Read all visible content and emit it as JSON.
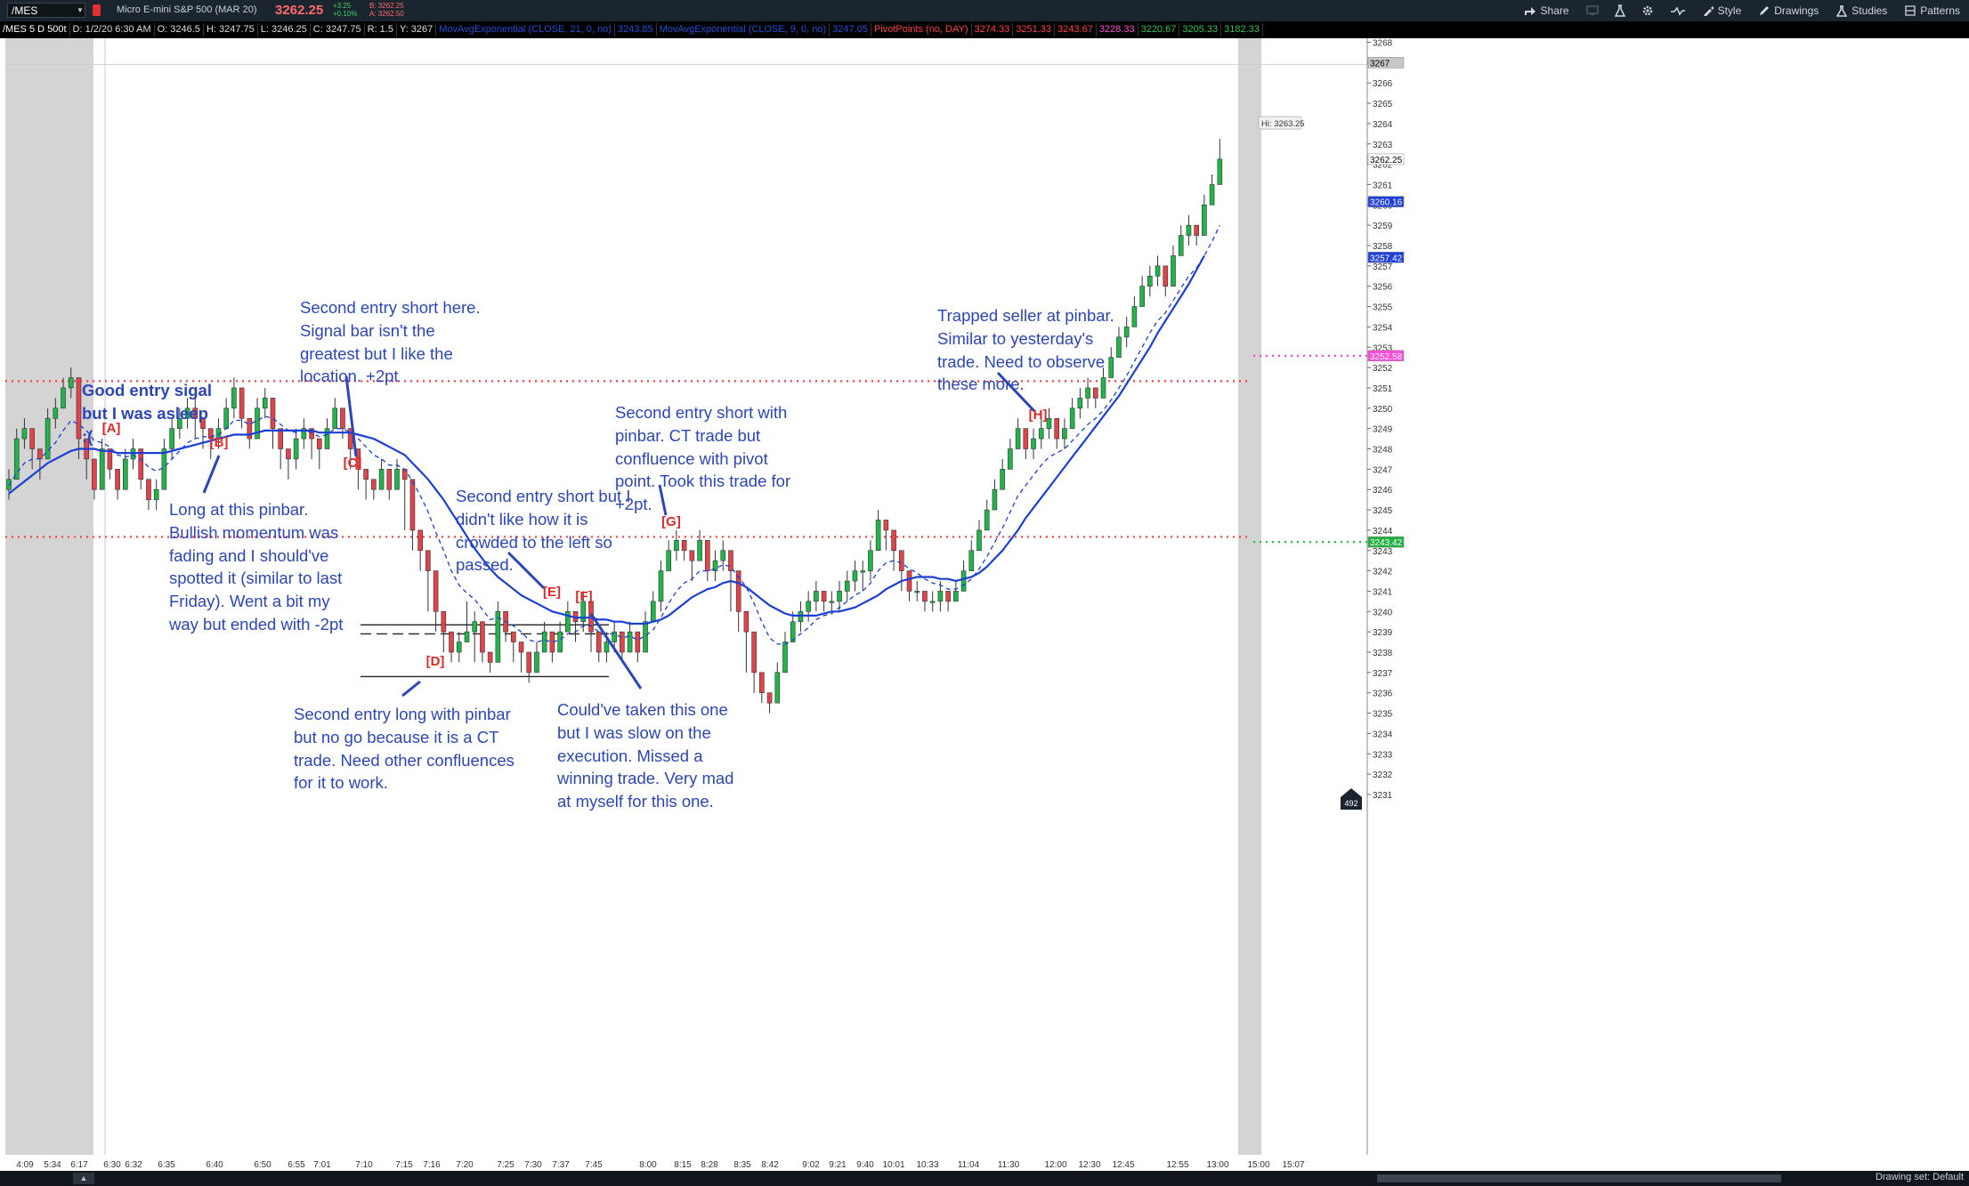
{
  "header": {
    "symbol": "/MES",
    "description": "Micro E-mini S&P 500 (MAR 20)",
    "last": "3262.25",
    "change": "+3.25",
    "change_pct": "+0.10%",
    "bid": "B: 3262.25",
    "ask": "A: 3262.50",
    "tools": [
      "Share",
      "Style",
      "Drawings",
      "Studies",
      "Patterns"
    ]
  },
  "studybar": {
    "items": [
      {
        "text": "/MES 5 D 500t",
        "color": "#ffffff"
      },
      {
        "text": "D: 1/2/20 6:30 AM",
        "color": "#dddddd"
      },
      {
        "text": "O: 3246.5",
        "color": "#dddddd"
      },
      {
        "text": "H: 3247.75",
        "color": "#dddddd"
      },
      {
        "text": "L: 3246.25",
        "color": "#dddddd"
      },
      {
        "text": "C: 3247.75",
        "color": "#dddddd"
      },
      {
        "text": "R: 1.5",
        "color": "#dddddd"
      },
      {
        "text": "Y: 3267",
        "color": "#dddddd"
      },
      {
        "text": "MovAvgExponential (CLOSE, 21, 0, no)",
        "color": "#1e4fd8"
      },
      {
        "text": "3243.85",
        "color": "#1e4fd8"
      },
      {
        "text": "MovAvgExponential (CLOSE, 9, 0, no)",
        "color": "#1e4fd8"
      },
      {
        "text": "3247.05",
        "color": "#1e4fd8"
      },
      {
        "text": "PivotPoints (no, DAY)",
        "color": "#ff4040"
      },
      {
        "text": "3274.33",
        "color": "#ff4040"
      },
      {
        "text": "3251.33",
        "color": "#ff4040"
      },
      {
        "text": "3243.67",
        "color": "#ff4040"
      },
      {
        "text": "3228.33",
        "color": "#ff4bd8"
      },
      {
        "text": "3220.67",
        "color": "#31c44a"
      },
      {
        "text": "3205.33",
        "color": "#31c44a"
      },
      {
        "text": "3182.33",
        "color": "#31c44a"
      }
    ]
  },
  "chart_data": {
    "type": "candlestick",
    "ylim": [
      3230,
      3268
    ],
    "y_ticks": [
      3231,
      3232,
      3233,
      3234,
      3235,
      3236,
      3237,
      3238,
      3239,
      3240,
      3241,
      3242,
      3243,
      3244,
      3245,
      3246,
      3247,
      3248,
      3249,
      3250,
      3251,
      3252,
      3253,
      3254,
      3255,
      3256,
      3257,
      3258,
      3259,
      3260,
      3261,
      3262,
      3263,
      3264,
      3265,
      3266,
      3267,
      3268
    ],
    "x_ticks": [
      "4:09",
      "5:34",
      "6:17",
      "6:30",
      "6:32",
      "6:35",
      "6:40",
      "6:50",
      "6:55",
      "7:01",
      "7:10",
      "7:15",
      "7:16",
      "7:20",
      "7:25",
      "7:30",
      "7:37",
      "7:45",
      "8:00",
      "8:15",
      "8:28",
      "8:35",
      "8:42",
      "9:02",
      "9:21",
      "9:40",
      "10:01",
      "10:33",
      "11:04",
      "11:30",
      "12:00",
      "12:30",
      "12:45",
      "12:55",
      "13:00",
      "15:00",
      "15:07"
    ],
    "closes": [
      3246.5,
      3248.5,
      3249,
      3248,
      3247.5,
      3249.5,
      3250,
      3251,
      3251.5,
      3248.5,
      3247.5,
      3246,
      3248,
      3247,
      3246,
      3247.5,
      3248,
      3246.5,
      3245.5,
      3246,
      3248,
      3249,
      3249.5,
      3250,
      3249.5,
      3249,
      3248.5,
      3249,
      3250,
      3251,
      3249.5,
      3248.5,
      3250,
      3250.5,
      3249,
      3248,
      3247.5,
      3248.5,
      3249,
      3248.5,
      3248,
      3249,
      3250,
      3249,
      3248,
      3247,
      3246.5,
      3246,
      3247,
      3246,
      3247,
      3246.5,
      3244,
      3243,
      3242,
      3240,
      3239,
      3238,
      3238.5,
      3239,
      3239.5,
      3238,
      3237.5,
      3240,
      3239,
      3238.5,
      3238,
      3237,
      3238,
      3239,
      3238,
      3239,
      3240,
      3239.5,
      3240.5,
      3239,
      3238,
      3238.5,
      3239,
      3238,
      3239,
      3238,
      3239.5,
      3240.5,
      3242,
      3243,
      3243.5,
      3243,
      3242.5,
      3243.5,
      3242,
      3242.5,
      3243,
      3242,
      3240,
      3239,
      3237,
      3236,
      3235.5,
      3237,
      3238.5,
      3239.5,
      3240,
      3240.5,
      3241,
      3240.5,
      3240.5,
      3241,
      3241.5,
      3242,
      3242,
      3243,
      3244.5,
      3244,
      3243,
      3242,
      3241,
      3241,
      3240.5,
      3240.5,
      3241,
      3240.5,
      3241,
      3242,
      3243,
      3244,
      3245,
      3246,
      3247,
      3248,
      3249,
      3248,
      3248.5,
      3249,
      3249.5,
      3248.5,
      3249,
      3250,
      3250.5,
      3251,
      3250.5,
      3251.5,
      3252.5,
      3253.5,
      3254,
      3255,
      3256,
      3256.5,
      3257,
      3256,
      3257.5,
      3258.5,
      3259,
      3258.5,
      3260,
      3261,
      3262.25
    ],
    "highs": [
      3247,
      3249,
      3249.5,
      3248.5,
      3248,
      3250,
      3250.5,
      3251.5,
      3252,
      3249,
      3248.5,
      3246.5,
      3248.5,
      3247.5,
      3246.5,
      3248,
      3248.5,
      3247,
      3246,
      3246.5,
      3248.5,
      3249.5,
      3250,
      3250.5,
      3250.5,
      3249.5,
      3249,
      3249.5,
      3250.5,
      3251.5,
      3250,
      3249,
      3250.5,
      3251,
      3249.5,
      3248.5,
      3248,
      3249,
      3249.5,
      3249,
      3248.5,
      3249.5,
      3250.5,
      3249.5,
      3248.5,
      3247.5,
      3247,
      3246.5,
      3247.5,
      3246.5,
      3247.5,
      3247,
      3244.5,
      3243.5,
      3242.5,
      3240.5,
      3239.5,
      3238.5,
      3239,
      3240.5,
      3240,
      3238.5,
      3238,
      3240.5,
      3239.5,
      3239,
      3238.5,
      3237.5,
      3238.5,
      3239.5,
      3238.5,
      3239.5,
      3240.5,
      3240,
      3241,
      3239.5,
      3238.5,
      3239,
      3239.5,
      3238.5,
      3239.5,
      3238.5,
      3240,
      3241,
      3242.5,
      3243.5,
      3244,
      3243.5,
      3243,
      3244,
      3242.5,
      3243,
      3243.5,
      3242.5,
      3240.5,
      3239.5,
      3237.5,
      3236.5,
      3236,
      3237.5,
      3239,
      3240,
      3240.5,
      3241,
      3241.5,
      3241,
      3241,
      3241.5,
      3242,
      3242.5,
      3242.5,
      3243.5,
      3245,
      3244.5,
      3243.5,
      3242.5,
      3241.5,
      3241.5,
      3241,
      3241,
      3241.5,
      3241,
      3241.5,
      3242.5,
      3243.5,
      3244.5,
      3245.5,
      3246.5,
      3247.5,
      3248.5,
      3249.5,
      3248.5,
      3249,
      3249.5,
      3250,
      3249,
      3249.5,
      3250.5,
      3251,
      3251.5,
      3251,
      3252,
      3253,
      3254,
      3254.5,
      3255.5,
      3256.5,
      3257,
      3257.5,
      3256.5,
      3258,
      3259,
      3259.5,
      3259,
      3260.5,
      3261.5,
      3263.25
    ],
    "lows": [
      3245.5,
      3246.5,
      3248,
      3247,
      3246.5,
      3248.5,
      3249,
      3250,
      3250.5,
      3247.5,
      3246.5,
      3245.5,
      3246,
      3246.5,
      3245.5,
      3246,
      3247,
      3246,
      3245,
      3245,
      3246,
      3247.5,
      3248.5,
      3249,
      3248.5,
      3248,
      3247.5,
      3248,
      3249,
      3249.5,
      3249,
      3248,
      3248.5,
      3249.5,
      3248,
      3247,
      3246.5,
      3247,
      3248,
      3247.5,
      3247,
      3248,
      3249,
      3248.5,
      3247,
      3246,
      3245.5,
      3245.5,
      3246,
      3245.5,
      3246,
      3244,
      3243,
      3242,
      3240,
      3239,
      3238,
      3237.5,
      3237.5,
      3238.5,
      3237.5,
      3237.5,
      3237,
      3237.5,
      3238.5,
      3237.5,
      3237,
      3236.5,
      3237,
      3238,
      3237.5,
      3238,
      3239,
      3238.5,
      3239,
      3238,
      3237.5,
      3237.5,
      3238,
      3237.5,
      3238,
      3237.5,
      3238,
      3239.5,
      3240,
      3242,
      3242.5,
      3242.5,
      3241.5,
      3242.5,
      3241.5,
      3241.5,
      3242,
      3240,
      3239,
      3237,
      3236,
      3235.5,
      3235,
      3235.5,
      3237,
      3238.5,
      3239,
      3239.5,
      3240,
      3240,
      3240,
      3240,
      3240.5,
      3241,
      3241,
      3241.5,
      3243,
      3243,
      3242,
      3241,
      3240.5,
      3240.5,
      3240,
      3240,
      3240,
      3240,
      3240.5,
      3241,
      3242,
      3243,
      3244,
      3245,
      3246,
      3247,
      3248,
      3247.5,
      3247.5,
      3248,
      3248.5,
      3248,
      3248,
      3249,
      3249.5,
      3250,
      3250,
      3250.5,
      3251.5,
      3252.5,
      3253,
      3254,
      3255,
      3255.5,
      3256,
      3255.5,
      3256,
      3257.5,
      3258,
      3258,
      3258.5,
      3260,
      3261
    ],
    "ema21": [
      3245.8,
      3246.1,
      3246.4,
      3246.7,
      3247.0,
      3247.3,
      3247.5,
      3247.7,
      3247.9,
      3248.0,
      3248.0,
      3248.0,
      3247.9,
      3247.9,
      3247.8,
      3247.8,
      3247.8,
      3247.8,
      3247.8,
      3247.8,
      3247.8,
      3247.9,
      3248.0,
      3248.1,
      3248.2,
      3248.3,
      3248.4,
      3248.5,
      3248.6,
      3248.7,
      3248.7,
      3248.7,
      3248.8,
      3248.9,
      3248.9,
      3248.9,
      3248.9,
      3248.9,
      3248.9,
      3248.9,
      3248.8,
      3248.8,
      3248.8,
      3248.8,
      3248.8,
      3248.7,
      3248.6,
      3248.5,
      3248.3,
      3248.1,
      3247.9,
      3247.7,
      3247.3,
      3246.9,
      3246.5,
      3246.0,
      3245.5,
      3244.9,
      3244.3,
      3243.7,
      3243.1,
      3242.6,
      3242.1,
      3241.7,
      3241.4,
      3241.1,
      3240.8,
      3240.6,
      3240.4,
      3240.2,
      3240.0,
      3239.9,
      3239.8,
      3239.7,
      3239.7,
      3239.7,
      3239.6,
      3239.6,
      3239.5,
      3239.5,
      3239.4,
      3239.4,
      3239.4,
      3239.5,
      3239.6,
      3239.8,
      3240.1,
      3240.4,
      3240.7,
      3240.9,
      3241.1,
      3241.2,
      3241.4,
      3241.5,
      3241.4,
      3241.2,
      3240.9,
      3240.6,
      3240.3,
      3240.1,
      3239.9,
      3239.8,
      3239.8,
      3239.8,
      3239.8,
      3239.9,
      3240.0,
      3240.0,
      3240.1,
      3240.2,
      3240.4,
      3240.6,
      3240.8,
      3241.1,
      3241.3,
      3241.5,
      3241.6,
      3241.7,
      3241.7,
      3241.7,
      3241.6,
      3241.6,
      3241.5,
      3241.6,
      3241.7,
      3241.9,
      3242.2,
      3242.6,
      3243.0,
      3243.5,
      3244.0,
      3244.6,
      3245.1,
      3245.6,
      3246.1,
      3246.6,
      3247.1,
      3247.6,
      3248.1,
      3248.6,
      3249.1,
      3249.6,
      3250.1,
      3250.6,
      3251.2,
      3251.8,
      3252.4,
      3253.0,
      3253.7,
      3254.3,
      3254.9,
      3255.5,
      3256.1,
      3256.8,
      3257.5
    ],
    "ema9": [
      3246.2,
      3246.8,
      3247.3,
      3247.5,
      3247.5,
      3247.9,
      3248.3,
      3248.9,
      3249.4,
      3249.2,
      3248.9,
      3248.4,
      3248.3,
      3248.1,
      3247.7,
      3247.6,
      3247.7,
      3247.5,
      3247.1,
      3246.9,
      3247.1,
      3247.5,
      3247.9,
      3248.3,
      3248.5,
      3248.6,
      3248.6,
      3248.7,
      3249.0,
      3249.4,
      3249.4,
      3249.2,
      3249.4,
      3249.6,
      3249.5,
      3249.2,
      3248.9,
      3248.8,
      3248.9,
      3248.8,
      3248.6,
      3248.7,
      3249.0,
      3249.0,
      3248.8,
      3248.5,
      3248.1,
      3247.7,
      3247.5,
      3247.2,
      3247.2,
      3247.0,
      3246.4,
      3245.7,
      3244.9,
      3243.9,
      3243.0,
      3242.0,
      3241.3,
      3240.9,
      3240.6,
      3240.1,
      3239.6,
      3239.7,
      3239.5,
      3239.3,
      3239.0,
      3238.6,
      3238.5,
      3238.6,
      3238.5,
      3238.6,
      3238.9,
      3239.0,
      3239.3,
      3239.3,
      3239.0,
      3238.9,
      3238.9,
      3238.7,
      3238.8,
      3238.6,
      3238.8,
      3239.1,
      3239.7,
      3240.4,
      3241.0,
      3241.4,
      3241.6,
      3242.0,
      3242.0,
      3242.1,
      3242.3,
      3242.2,
      3241.7,
      3241.2,
      3240.4,
      3239.5,
      3238.7,
      3238.4,
      3238.4,
      3238.6,
      3238.9,
      3239.2,
      3239.6,
      3239.8,
      3239.9,
      3240.2,
      3240.5,
      3240.8,
      3241.0,
      3241.4,
      3242.0,
      3242.4,
      3242.5,
      3242.4,
      3242.1,
      3241.9,
      3241.6,
      3241.4,
      3241.3,
      3241.1,
      3241.1,
      3241.3,
      3241.6,
      3242.1,
      3242.7,
      3243.4,
      3244.1,
      3244.9,
      3245.7,
      3246.2,
      3246.7,
      3247.2,
      3247.6,
      3247.8,
      3248.0,
      3248.4,
      3248.8,
      3249.2,
      3249.5,
      3249.9,
      3250.4,
      3251.0,
      3251.6,
      3252.3,
      3253.0,
      3253.7,
      3254.3,
      3254.7,
      3255.3,
      3255.9,
      3256.5,
      3256.9,
      3257.5,
      3258.2,
      3259.0
    ],
    "pivot_lines": [
      {
        "level": 3251.33,
        "color": "#ff3b3b"
      },
      {
        "level": 3243.67,
        "color": "#ff3b3b"
      }
    ],
    "price_labels": [
      {
        "value": "3267",
        "bg": "#c7c7c7",
        "color": "#000000",
        "level": 3267
      },
      {
        "value": "3262.25",
        "bg": "#ffffff",
        "color": "#000000",
        "level": 3262.25
      },
      {
        "value": "3260.16",
        "bg": "#1e3fd8",
        "color": "#ffffff",
        "level": 3260.16
      },
      {
        "value": "3257.42",
        "bg": "#1e3fd8",
        "color": "#ffffff",
        "level": 3257.42
      },
      {
        "value": "3252.58",
        "bg": "#ff4bd8",
        "color": "#ffffff",
        "level": 3252.58
      },
      {
        "value": "3243.42",
        "bg": "#22b040",
        "color": "#ffffff",
        "level": 3243.42
      }
    ],
    "hi_label": "Hi: 3263.25",
    "pdr_high": 3243.5,
    "pdr_low": 3236.8,
    "pdr_mid": 3238.9,
    "colors": {
      "up": "#21b44a",
      "down": "#e0434a",
      "ema21": "#1a3fd6",
      "ema9": "#1a3fd6",
      "session_shade": "#d4d4d4",
      "magenta": "#ff40d0",
      "green_line": "#22c040"
    }
  },
  "markers": [
    {
      "text": "[A]",
      "bar": 18,
      "level": 3249.1
    },
    {
      "text": "[B]",
      "bar": 35,
      "level": 3248.5
    },
    {
      "text": "[C]",
      "bar": 57,
      "level": 3247.0
    },
    {
      "text": "[D]",
      "bar": 73,
      "level": 3236.6
    },
    {
      "text": "[E]",
      "bar": 93,
      "level": 3241.1
    },
    {
      "text": "[F]",
      "bar": 99,
      "level": 3240.9
    },
    {
      "text": "[G]",
      "bar": 113,
      "level": 3243.9
    },
    {
      "text": "[H]",
      "bar": 164,
      "level": 3249.7
    }
  ],
  "annotations": [
    {
      "lines": [
        "Good entry sigal",
        "but I was asleep",
        ":("
      ],
      "bold": true
    },
    {
      "lines": [
        "Second entry short here.",
        "Signal bar isn't the",
        "greatest but I like the",
        "location. +2pt"
      ],
      "bold": false
    },
    {
      "lines": [
        "Long at this pinbar.",
        "Bullish momentum was",
        "fading and I should've",
        "spotted it (similar to last",
        "Friday). Went a bit my",
        "way but ended with -2pt"
      ],
      "bold": false
    },
    {
      "lines": [
        "Second entry short but I",
        "didn't like how it is",
        "crowded to the left so",
        "passed."
      ],
      "bold": false
    },
    {
      "lines": [
        "Second entry short with",
        "pinbar. CT trade but",
        "confluence with pivot",
        "point. Took this trade for",
        "+2pt."
      ],
      "bold": false
    },
    {
      "lines": [
        "Trapped seller at pinbar.",
        "Similar to yesterday's",
        "trade. Need to observe",
        "these more."
      ],
      "bold": false
    },
    {
      "lines": [
        "Second entry long with pinbar",
        "but no go because it is a CT",
        "trade. Need other confluences",
        "for it to work."
      ],
      "bold": false
    },
    {
      "lines": [
        "Could've taken this one",
        "but I was slow on the",
        "execution. Missed a",
        "winning trade. Very mad",
        "at myself for this one."
      ],
      "bold": false
    }
  ],
  "footer": {
    "count_badge": "492",
    "drawing_set": "Drawing set: Default"
  }
}
